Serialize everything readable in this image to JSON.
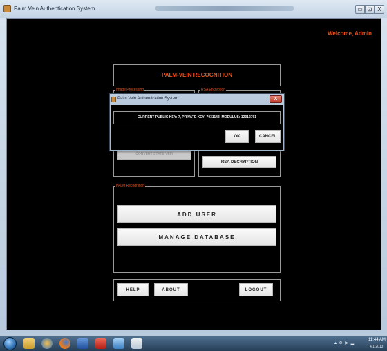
{
  "window": {
    "title": "Palm Vein Authentication System",
    "controls": {
      "minimize": "▭",
      "maximize": "⊡",
      "close": "X"
    }
  },
  "header": {
    "welcome": "Welcome, Admin",
    "title": "PALM-VEIN  RECOGNITION"
  },
  "panels": {
    "image_processing": {
      "legend": "Image Processing",
      "faded_button": "CONVERT STATE VEIN"
    },
    "rsa": {
      "legend": "RSA Encryption",
      "decrypt_button": "RSA DECRYPTION"
    },
    "palm": {
      "legend": "PALM Recognition",
      "add_user": "ADD USER",
      "manage_database": "MANAGE DATABASE"
    }
  },
  "footer": {
    "help": "HELP",
    "about": "ABOUT",
    "logout": "LOGOUT"
  },
  "dialog": {
    "title": "Palm Vein Authentication System",
    "close": "X",
    "message": "CURRENT PUBLIC KEY: 7, PRIVATE KEY: 7031143, MODULUS: 12312761",
    "ok": "OK",
    "cancel": "CANCEL"
  },
  "taskbar": {
    "icons": [
      "start-orb-icon",
      "file-explorer-icon",
      "media-player-icon",
      "firefox-icon",
      "word-icon",
      "acrobat-icon",
      "shield-icon",
      "notepad-icon"
    ],
    "tray": "▴ ⊕ ▶ ▂",
    "time": "11:44 AM",
    "date": "4/1/2013"
  },
  "colors": {
    "accent": "#e2531f",
    "background": "#000000"
  }
}
